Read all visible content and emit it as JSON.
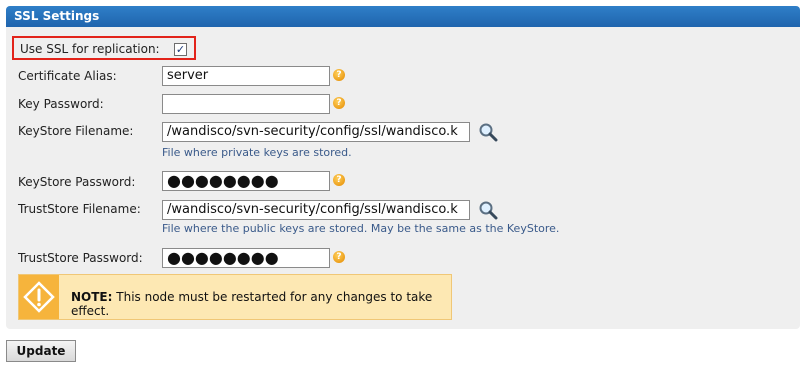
{
  "panel": {
    "title": "SSL Settings"
  },
  "form": {
    "use_ssl_label": "Use SSL for replication:",
    "use_ssl_checked": true,
    "certificate_alias_label": "Certificate Alias:",
    "certificate_alias_value": "server",
    "key_password_label": "Key Password:",
    "key_password_value": "",
    "keystore_filename_label": "KeyStore Filename:",
    "keystore_filename_value": "/wandisco/svn-security/config/ssl/wandisco.k",
    "keystore_filename_hint": "File where private keys are stored.",
    "keystore_password_label": "KeyStore Password:",
    "keystore_password_value": "●●●●●●●●",
    "truststore_filename_label": "TrustStore Filename:",
    "truststore_filename_value": "/wandisco/svn-security/config/ssl/wandisco.k",
    "truststore_filename_hint": "File where the public keys are stored. May be the same as the KeyStore.",
    "truststore_password_label": "TrustStore Password:",
    "truststore_password_value": "●●●●●●●●"
  },
  "note": {
    "prefix": "NOTE:",
    "text": " This node must be restarted for any changes to take effect."
  },
  "actions": {
    "update_label": "Update"
  },
  "icons": {
    "help": "help-icon",
    "search": "magnifier-icon",
    "warning": "warning-icon"
  },
  "colors": {
    "header": "#1f64ad",
    "highlight_border": "#e2231a",
    "note_background": "#fde8b3",
    "hint_text": "#3a5a8a"
  }
}
